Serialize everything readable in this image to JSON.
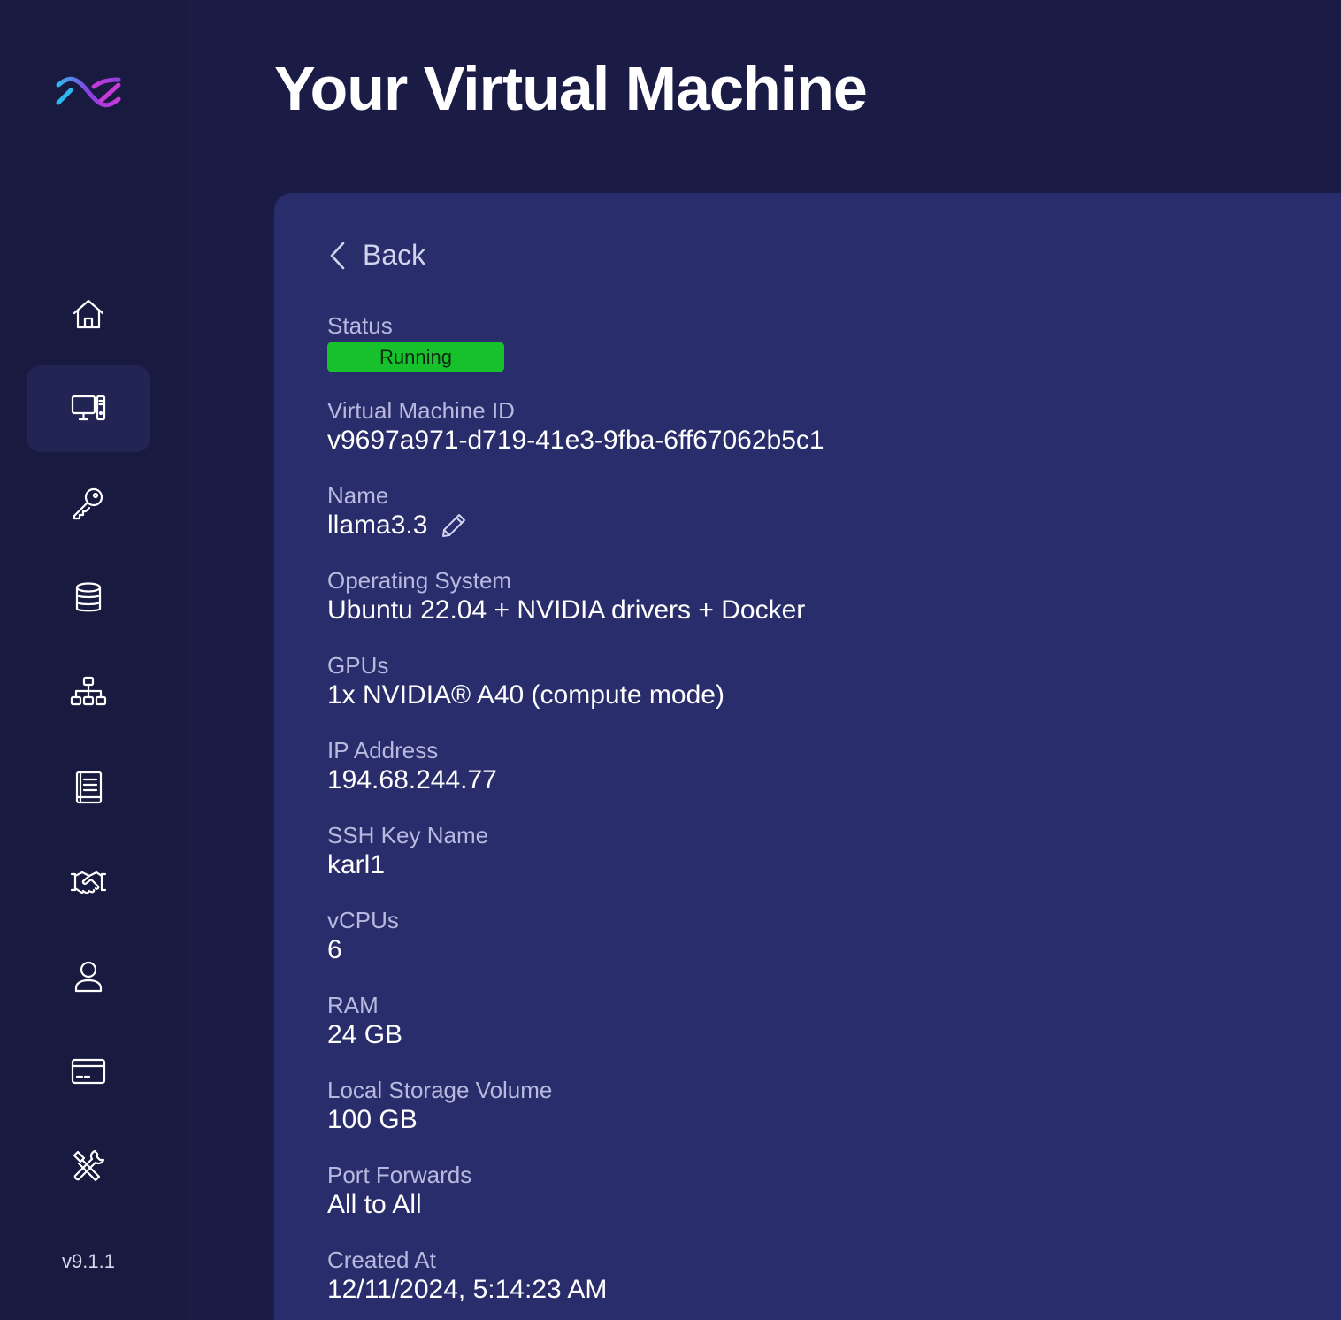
{
  "app": {
    "version": "v9.1.1",
    "brand_colors": {
      "cyan": "#2fb8f0",
      "magenta": "#c83ad8",
      "purple": "#8a3fe0"
    }
  },
  "sidebar": {
    "items": [
      {
        "name": "home",
        "icon": "home-icon",
        "active": false
      },
      {
        "name": "virtual-machines",
        "icon": "computer-icon",
        "active": true
      },
      {
        "name": "ssh-keys",
        "icon": "key-icon",
        "active": false
      },
      {
        "name": "storage",
        "icon": "database-icon",
        "active": false
      },
      {
        "name": "network",
        "icon": "network-icon",
        "active": false
      },
      {
        "name": "docs",
        "icon": "book-icon",
        "active": false
      },
      {
        "name": "partners",
        "icon": "handshake-icon",
        "active": false
      },
      {
        "name": "account",
        "icon": "user-icon",
        "active": false
      },
      {
        "name": "billing",
        "icon": "credit-card-icon",
        "active": false
      },
      {
        "name": "tools",
        "icon": "tools-icon",
        "active": false
      }
    ]
  },
  "header": {
    "title": "Your Virtual Machine"
  },
  "panel": {
    "back_label": "Back",
    "status": {
      "label": "Status",
      "value": "Running",
      "color": "#17c12c"
    },
    "vm_id": {
      "label": "Virtual Machine ID",
      "value": "v9697a971-d719-41e3-9fba-6ff67062b5c1"
    },
    "name": {
      "label": "Name",
      "value": "llama3.3"
    },
    "os": {
      "label": "Operating System",
      "value": "Ubuntu 22.04 + NVIDIA drivers + Docker"
    },
    "gpus": {
      "label": "GPUs",
      "value": "1x NVIDIA® A40 (compute mode)"
    },
    "ip": {
      "label": "IP Address",
      "value": "194.68.244.77"
    },
    "ssh": {
      "label": "SSH Key Name",
      "value": "karl1"
    },
    "vcpus": {
      "label": "vCPUs",
      "value": "6"
    },
    "ram": {
      "label": "RAM",
      "value": "24 GB"
    },
    "storage": {
      "label": "Local Storage Volume",
      "value": "100 GB"
    },
    "ports": {
      "label": "Port Forwards",
      "value": "All to All"
    },
    "created": {
      "label": "Created At",
      "value": "12/11/2024, 5:14:23 AM"
    }
  }
}
